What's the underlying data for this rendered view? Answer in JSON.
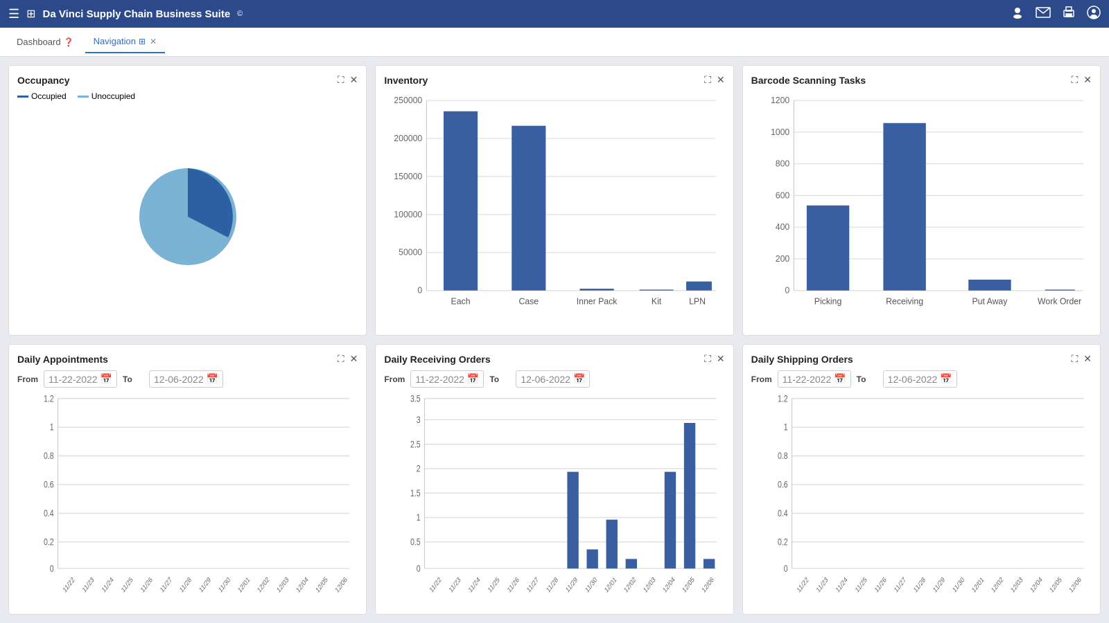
{
  "app": {
    "title": "Da Vinci Supply Chain Business Suite",
    "copyright": "©"
  },
  "topbar": {
    "menu_icon": "☰",
    "grid_icon": "⊞",
    "user_icon": "👤",
    "mail_icon": "✉",
    "print_icon": "🖨",
    "account_icon": "👤"
  },
  "tabs": [
    {
      "id": "dashboard",
      "label": "Dashboard",
      "active": false,
      "closable": false,
      "has_help": true
    },
    {
      "id": "navigation",
      "label": "Navigation",
      "active": true,
      "closable": true,
      "has_grid": true
    }
  ],
  "widgets": {
    "occupancy": {
      "title": "Occupancy",
      "legend": [
        {
          "label": "Occupied",
          "color": "#2d5fa3"
        },
        {
          "label": "Unoccupied",
          "color": "#7bb3d4"
        }
      ],
      "occupied_percent": 35,
      "unoccupied_percent": 65
    },
    "inventory": {
      "title": "Inventory",
      "bars": [
        {
          "label": "Each",
          "value": 235000
        },
        {
          "label": "Case",
          "value": 215000
        },
        {
          "label": "Inner Pack",
          "value": 2000
        },
        {
          "label": "Kit",
          "value": 500
        },
        {
          "label": "LPN",
          "value": 12000
        }
      ],
      "y_max": 250000,
      "y_labels": [
        "0",
        "50000",
        "100000",
        "150000",
        "200000",
        "250000"
      ]
    },
    "barcode_scanning": {
      "title": "Barcode Scanning Tasks",
      "bars": [
        {
          "label": "Picking",
          "value": 540
        },
        {
          "label": "Receiving",
          "value": 1060
        },
        {
          "label": "Put Away",
          "value": 70
        },
        {
          "label": "Work Order",
          "value": 0
        }
      ],
      "y_max": 1200,
      "y_labels": [
        "0",
        "200",
        "400",
        "600",
        "800",
        "1000",
        "1200"
      ]
    },
    "daily_appointments": {
      "title": "Daily Appointments",
      "from_label": "From",
      "to_label": "To",
      "from_date": "11-22-2022",
      "to_date": "12-06-2022",
      "bars": [],
      "y_labels": [
        "0",
        "0.2",
        "0.4",
        "0.6",
        "0.8",
        "1",
        "1.2"
      ],
      "x_labels": [
        "11/22",
        "11/23",
        "11/24",
        "11/25",
        "11/26",
        "11/27",
        "11/28",
        "11/29",
        "11/30",
        "12/01",
        "12/02",
        "12/03",
        "12/04",
        "12/05",
        "12/06"
      ]
    },
    "daily_receiving": {
      "title": "Daily Receiving Orders",
      "from_label": "From",
      "to_label": "To",
      "from_date": "11-22-2022",
      "to_date": "12-06-2022",
      "bars": [
        {
          "date": "11/29",
          "value": 2
        },
        {
          "date": "11/30",
          "value": 0.4
        },
        {
          "date": "12/01",
          "value": 1
        },
        {
          "date": "12/02",
          "value": 0.2
        },
        {
          "date": "12/04",
          "value": 2
        },
        {
          "date": "12/05",
          "value": 3
        },
        {
          "date": "12/06",
          "value": 0.2
        }
      ],
      "y_max": 3.5,
      "y_labels": [
        "0",
        "0.5",
        "1",
        "1.5",
        "2",
        "2.5",
        "3",
        "3.5"
      ],
      "x_labels": [
        "11/22",
        "11/23",
        "11/24",
        "11/25",
        "11/26",
        "11/27",
        "11/28",
        "11/29",
        "11/30",
        "12/01",
        "12/02",
        "12/03",
        "12/04",
        "12/05",
        "12/06"
      ]
    },
    "daily_shipping": {
      "title": "Daily Shipping Orders",
      "from_label": "From",
      "to_label": "To",
      "from_date": "11-22-2022",
      "to_date": "12-06-2022",
      "bars": [],
      "y_labels": [
        "0",
        "0.2",
        "0.4",
        "0.6",
        "0.8",
        "1",
        "1.2"
      ],
      "x_labels": [
        "11/22",
        "11/23",
        "11/24",
        "11/25",
        "11/26",
        "11/27",
        "11/28",
        "11/29",
        "11/30",
        "12/01",
        "12/02",
        "12/03",
        "12/04",
        "12/05",
        "12/06"
      ]
    }
  },
  "colors": {
    "bar_fill": "#3a5fa0",
    "bar_fill_light": "#6b94c9",
    "grid_line": "#e0e0e0",
    "axis_text": "#555",
    "accent": "#2c6fd1"
  }
}
